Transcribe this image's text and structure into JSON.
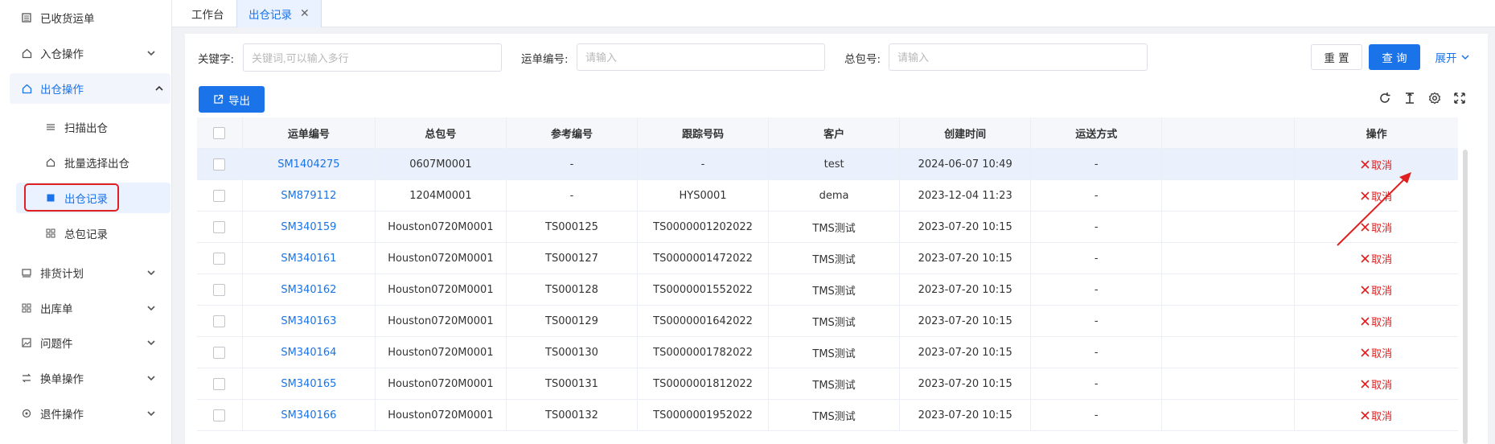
{
  "sidebar": {
    "items": [
      {
        "label": "已收货运单",
        "icon": "list-icon"
      },
      {
        "label": "入仓操作",
        "icon": "warehouse-in-icon"
      },
      {
        "label": "出仓操作",
        "icon": "warehouse-out-icon"
      },
      {
        "label": "扫描出仓",
        "icon": "scan-icon"
      },
      {
        "label": "批量选择出仓",
        "icon": "home-icon"
      },
      {
        "label": "出仓记录",
        "icon": "record-icon"
      },
      {
        "label": "总包记录",
        "icon": "grid-icon"
      },
      {
        "label": "排货计划",
        "icon": "plan-icon"
      },
      {
        "label": "出库单",
        "icon": "grid-icon"
      },
      {
        "label": "问题件",
        "icon": "image-icon"
      },
      {
        "label": "换单操作",
        "icon": "exchange-icon"
      },
      {
        "label": "退件操作",
        "icon": "return-icon"
      }
    ]
  },
  "tabs": [
    {
      "label": "工作台"
    },
    {
      "label": "出仓记录",
      "close": "✕"
    }
  ],
  "filters": {
    "keyword_label": "关键字:",
    "keyword_placeholder": "关键词,可以输入多行",
    "waybill_label": "运单编号:",
    "waybill_placeholder": "请输入",
    "package_label": "总包号:",
    "package_placeholder": "请输入"
  },
  "buttons": {
    "reset": "重 置",
    "search": "查 询",
    "expand": "展开",
    "export": "导出"
  },
  "table": {
    "headers": [
      "运单编号",
      "总包号",
      "参考编号",
      "跟踪号码",
      "客户",
      "创建时间",
      "运送方式",
      "",
      "操作"
    ],
    "cancel_label": "取消",
    "rows": [
      {
        "waybill": "SM1404275",
        "package": "0607M0001",
        "ref": "-",
        "tracking": "-",
        "customer": "test",
        "created": "2024-06-07 10:49",
        "shipping": "-"
      },
      {
        "waybill": "SM879112",
        "package": "1204M0001",
        "ref": "-",
        "tracking": "HYS0001",
        "customer": "dema",
        "created": "2023-12-04 11:23",
        "shipping": "-"
      },
      {
        "waybill": "SM340159",
        "package": "Houston0720M0001",
        "ref": "TS000125",
        "tracking": "TS0000001202022",
        "customer": "TMS测试",
        "created": "2023-07-20 10:15",
        "shipping": "-"
      },
      {
        "waybill": "SM340161",
        "package": "Houston0720M0001",
        "ref": "TS000127",
        "tracking": "TS0000001472022",
        "customer": "TMS测试",
        "created": "2023-07-20 10:15",
        "shipping": "-"
      },
      {
        "waybill": "SM340162",
        "package": "Houston0720M0001",
        "ref": "TS000128",
        "tracking": "TS0000001552022",
        "customer": "TMS测试",
        "created": "2023-07-20 10:15",
        "shipping": "-"
      },
      {
        "waybill": "SM340163",
        "package": "Houston0720M0001",
        "ref": "TS000129",
        "tracking": "TS0000001642022",
        "customer": "TMS测试",
        "created": "2023-07-20 10:15",
        "shipping": "-"
      },
      {
        "waybill": "SM340164",
        "package": "Houston0720M0001",
        "ref": "TS000130",
        "tracking": "TS0000001782022",
        "customer": "TMS测试",
        "created": "2023-07-20 10:15",
        "shipping": "-"
      },
      {
        "waybill": "SM340165",
        "package": "Houston0720M0001",
        "ref": "TS000131",
        "tracking": "TS0000001812022",
        "customer": "TMS测试",
        "created": "2023-07-20 10:15",
        "shipping": "-"
      },
      {
        "waybill": "SM340166",
        "package": "Houston0720M0001",
        "ref": "TS000132",
        "tracking": "TS0000001952022",
        "customer": "TMS测试",
        "created": "2023-07-20 10:15",
        "shipping": "-"
      }
    ]
  },
  "colors": {
    "accent": "#1a73e8",
    "danger": "#e02020",
    "highlight_row": "#eaf1fc"
  }
}
